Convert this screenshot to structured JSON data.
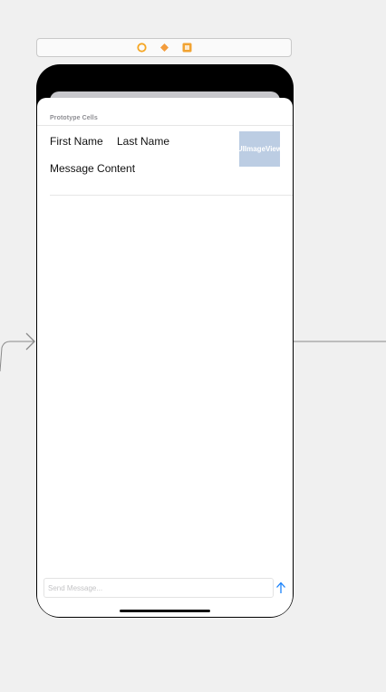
{
  "scene_dock": {
    "icons": [
      "view-controller-icon",
      "first-responder-icon",
      "exit-icon"
    ],
    "colors": {
      "view_controller": "#f5a623",
      "first_responder": "#f39c3c",
      "exit": "#f1a332"
    }
  },
  "table": {
    "section_header": "Prototype Cells",
    "cell": {
      "first_name": "First Name",
      "last_name": "Last Name",
      "message": "Message Content",
      "image_placeholder": "UIImageView"
    }
  },
  "composer": {
    "placeholder": "Send Message...",
    "send_icon": "arrow-up-icon"
  },
  "colors": {
    "canvas": "#f0f0f0",
    "phone_frame": "#000000",
    "image_view": "#bccde3",
    "send_accent": "#1a82fb",
    "segue_line": "#8a8a8a"
  }
}
